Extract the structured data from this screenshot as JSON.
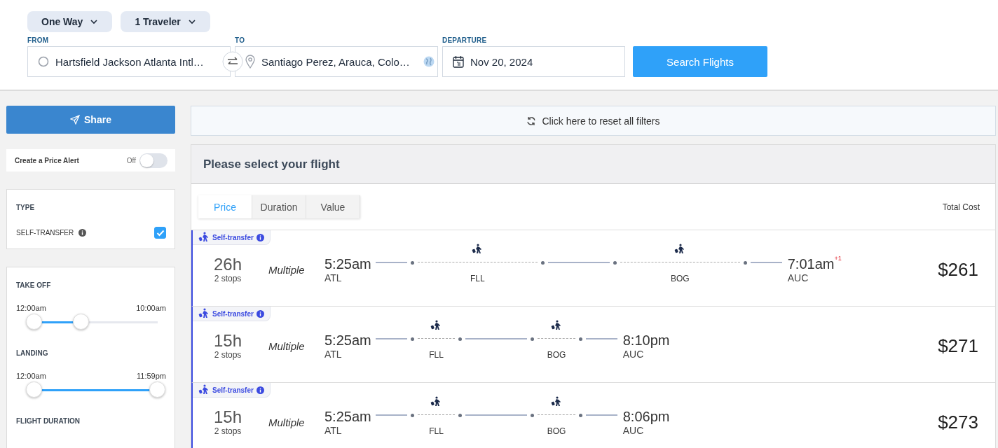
{
  "search": {
    "trip_type": "One Way",
    "travelers": "1 Traveler",
    "from": {
      "label": "FROM",
      "value": "Hartsfield Jackson Atlanta Intl…"
    },
    "to": {
      "label": "TO",
      "value": "Santiago Perez, Arauca, Colo…"
    },
    "departure": {
      "label": "DEPARTURE",
      "value": "Nov 20, 2024"
    },
    "search_button": "Search Flights"
  },
  "sidebar": {
    "share_button": "Share",
    "price_alert": {
      "label": "Create a Price Alert",
      "state_text": "Off",
      "on": false
    },
    "type_filter": {
      "title": "TYPE",
      "options": [
        {
          "label": "SELF-TRANSFER",
          "checked": true
        }
      ]
    },
    "time_filters": [
      {
        "title": "TAKE OFF",
        "min_label": "12:00am",
        "max_label": "10:00am",
        "thumbs": [
          {
            "level": 0
          },
          {
            "level": 0.38
          }
        ]
      },
      {
        "title": "LANDING",
        "min_label": "12:00am",
        "max_label": "11:59pm",
        "thumbs": [
          {
            "level": 0
          },
          {
            "level": 1
          }
        ]
      }
    ],
    "next_section": "FLIGHT DURATION"
  },
  "reset_filters": "Click here to reset all filters",
  "results": {
    "title": "Please select your flight",
    "sort_tabs": [
      {
        "label": "Price",
        "selected": true
      },
      {
        "label": "Duration",
        "selected": false
      },
      {
        "label": "Value",
        "selected": false
      }
    ],
    "total_cost_label": "Total Cost",
    "flights": [
      {
        "badge": "Self-transfer",
        "duration": "26h",
        "stops_text": "2 stops",
        "airline": "Multiple",
        "depart_time": "5:25am",
        "depart_code": "ATL",
        "stops": [
          {
            "code": "FLL"
          },
          {
            "code": "BOG"
          }
        ],
        "arrive_time": "7:01am",
        "day_offset": "+1",
        "arrive_code": "AUC",
        "price": "$261"
      },
      {
        "badge": "Self-transfer",
        "duration": "15h",
        "stops_text": "2 stops",
        "airline": "Multiple",
        "depart_time": "5:25am",
        "depart_code": "ATL",
        "stops": [
          {
            "code": "FLL"
          },
          {
            "code": "BOG"
          }
        ],
        "arrive_time": "8:10pm",
        "arrive_code": "AUC",
        "price": "$271"
      },
      {
        "badge": "Self-transfer",
        "duration": "15h",
        "stops_text": "2 stops",
        "airline": "Multiple",
        "depart_time": "5:25am",
        "depart_code": "ATL",
        "stops": [
          {
            "code": "FLL"
          },
          {
            "code": "BOG"
          }
        ],
        "arrive_time": "8:06pm",
        "arrive_code": "AUC",
        "price": "$273"
      }
    ]
  }
}
